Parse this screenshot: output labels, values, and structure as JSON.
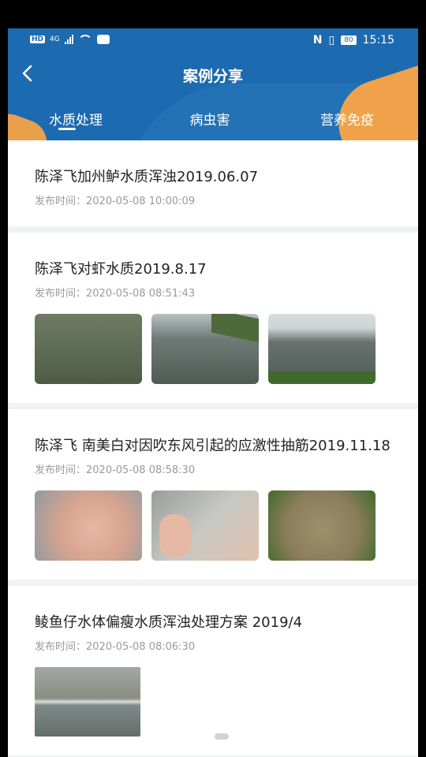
{
  "statusbar": {
    "left_badges": "HD",
    "network": "4G",
    "battery": "80",
    "time": "15:15"
  },
  "header": {
    "title": "案例分享",
    "back_label": "<"
  },
  "tabs": [
    {
      "label": "水质处理",
      "active": true
    },
    {
      "label": "病虫害",
      "active": false
    },
    {
      "label": "营养免疫",
      "active": false
    }
  ],
  "articles": [
    {
      "title": "陈泽飞加州鲈水质浑浊2019.06.07",
      "time_label": "发布时间：",
      "time": "2020-05-08 10:00:09",
      "images": []
    },
    {
      "title": "陈泽飞对虾水质2019.8.17",
      "time_label": "发布时间：",
      "time": "2020-05-08 08:51:43",
      "images": [
        "pond-water-photo",
        "pond-bank-photo",
        "pond-aerator-photo"
      ]
    },
    {
      "title": "陈泽飞 南美白对因吹东风引起的应激性抽筋2019.11.18",
      "time_label": "发布时间：",
      "time": "2020-05-08 08:58:30",
      "images": [
        "shrimp-in-hand-photo",
        "shrimp-held-photo",
        "shrimp-in-pan-photo"
      ]
    },
    {
      "title": "鲮鱼仔水体偏瘦水质浑浊处理方案 2019/4",
      "time_label": "发布时间：",
      "time": "2020-05-08 08:06:30",
      "images": [
        "pond-collage-photo"
      ]
    }
  ],
  "colors": {
    "header_blue": "#1c6ab0",
    "accent_orange": "#f0a24a"
  }
}
